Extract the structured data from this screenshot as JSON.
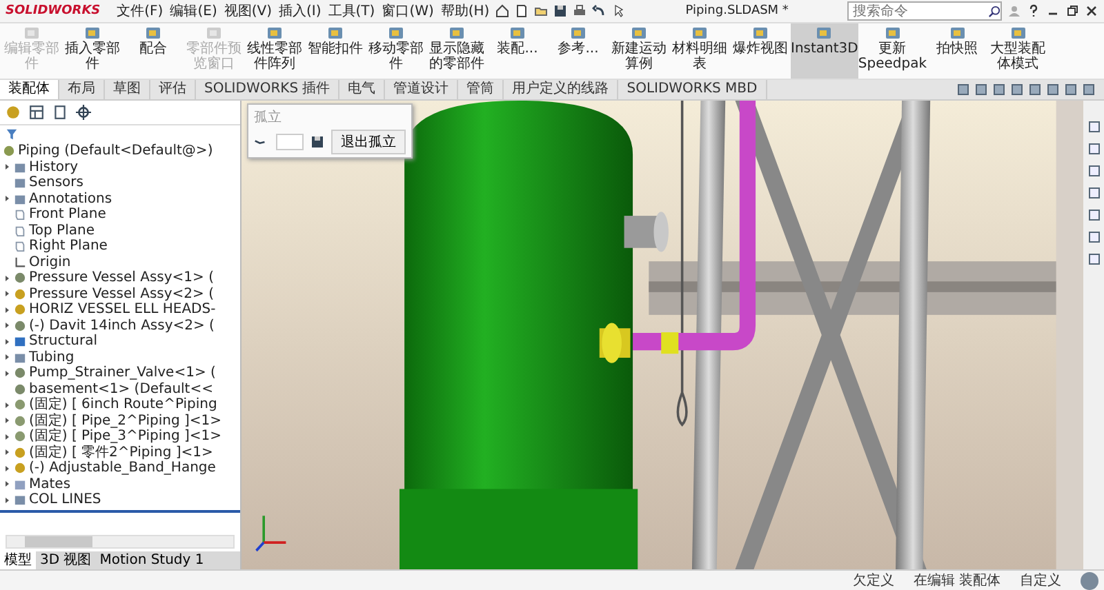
{
  "app": {
    "logo": "SOLIDWORKS",
    "title": "Piping.SLDASM *",
    "search": {
      "placeholder": "搜索命令"
    },
    "menu": [
      "文件(F)",
      "编辑(E)",
      "视图(V)",
      "插入(I)",
      "工具(T)",
      "窗口(W)",
      "帮助(H)"
    ]
  },
  "ribbon": [
    {
      "label": "编辑零部件",
      "disabled": true,
      "selected": false
    },
    {
      "label": "插入零部件",
      "disabled": false,
      "selected": false
    },
    {
      "label": "配合",
      "disabled": false,
      "selected": false
    },
    {
      "label": "零部件预览窗口",
      "disabled": true,
      "selected": false
    },
    {
      "label": "线性零部件阵列",
      "disabled": false,
      "selected": false
    },
    {
      "label": "智能扣件",
      "disabled": false,
      "selected": false
    },
    {
      "label": "移动零部件",
      "disabled": false,
      "selected": false
    },
    {
      "label": "显示隐藏的零部件",
      "disabled": false,
      "selected": false
    },
    {
      "label": "装配...",
      "disabled": false,
      "selected": false
    },
    {
      "label": "参考...",
      "disabled": false,
      "selected": false
    },
    {
      "label": "新建运动算例",
      "disabled": false,
      "selected": false
    },
    {
      "label": "材料明细表",
      "disabled": false,
      "selected": false
    },
    {
      "label": "爆炸视图",
      "disabled": false,
      "selected": false
    },
    {
      "label": "Instant3D",
      "disabled": false,
      "selected": true
    },
    {
      "label": "更新Speedpak",
      "disabled": false,
      "selected": false
    },
    {
      "label": "拍快照",
      "disabled": false,
      "selected": false
    },
    {
      "label": "大型装配体模式",
      "disabled": false,
      "selected": false
    }
  ],
  "tabs": [
    {
      "label": "装配体",
      "selected": true
    },
    {
      "label": "布局",
      "selected": false
    },
    {
      "label": "草图",
      "selected": false
    },
    {
      "label": "评估",
      "selected": false
    },
    {
      "label": "SOLIDWORKS 插件",
      "selected": false
    },
    {
      "label": "电气",
      "selected": false
    },
    {
      "label": "管道设计",
      "selected": false
    },
    {
      "label": "管筒",
      "selected": false
    },
    {
      "label": "用户定义的线路",
      "selected": false
    },
    {
      "label": "SOLIDWORKS MBD",
      "selected": false
    }
  ],
  "isolate_popup": {
    "title": "孤立",
    "button": "退出孤立"
  },
  "tree": {
    "root": "Piping  (Default<Default@>)",
    "items": [
      {
        "label": "History",
        "expandable": true,
        "kind": "folder"
      },
      {
        "label": "Sensors",
        "expandable": false,
        "kind": "folder"
      },
      {
        "label": "Annotations",
        "expandable": true,
        "kind": "folder"
      },
      {
        "label": "Front Plane",
        "expandable": false,
        "kind": "plane"
      },
      {
        "label": "Top Plane",
        "expandable": false,
        "kind": "plane"
      },
      {
        "label": "Right Plane",
        "expandable": false,
        "kind": "plane"
      },
      {
        "label": "Origin",
        "expandable": false,
        "kind": "origin"
      },
      {
        "label": "Pressure Vessel Assy<1> (",
        "expandable": true,
        "kind": "assembly"
      },
      {
        "label": "Pressure Vessel Assy<2> (",
        "expandable": true,
        "kind": "part"
      },
      {
        "label": "HORIZ VESSEL ELL HEADS-",
        "expandable": true,
        "kind": "part"
      },
      {
        "label": "(-) Davit 14inch Assy<2> (",
        "expandable": true,
        "kind": "assembly"
      },
      {
        "label": "Structural",
        "expandable": true,
        "kind": "structural"
      },
      {
        "label": "Tubing",
        "expandable": true,
        "kind": "folder"
      },
      {
        "label": "Pump_Strainer_Valve<1> (",
        "expandable": true,
        "kind": "assembly"
      },
      {
        "label": "basement<1> (Default<<",
        "expandable": false,
        "kind": "assembly"
      },
      {
        "label": "(固定) [ 6inch Route^Piping",
        "expandable": true,
        "kind": "route"
      },
      {
        "label": "(固定) [ Pipe_2^Piping ]<1>",
        "expandable": true,
        "kind": "route"
      },
      {
        "label": "(固定) [ Pipe_3^Piping ]<1>",
        "expandable": true,
        "kind": "route"
      },
      {
        "label": "(固定) [ 零件2^Piping ]<1>",
        "expandable": true,
        "kind": "part"
      },
      {
        "label": "(-) Adjustable_Band_Hange",
        "expandable": true,
        "kind": "part"
      },
      {
        "label": "Mates",
        "expandable": true,
        "kind": "mates"
      },
      {
        "label": "COL LINES",
        "expandable": true,
        "kind": "folder"
      }
    ]
  },
  "bottom_tabs": [
    {
      "label": "模型",
      "selected": true
    },
    {
      "label": "3D 视图",
      "selected": false
    },
    {
      "label": "Motion Study 1",
      "selected": false
    }
  ],
  "status_bar": [
    "欠定义",
    "在编辑 装配体",
    "自定义"
  ]
}
